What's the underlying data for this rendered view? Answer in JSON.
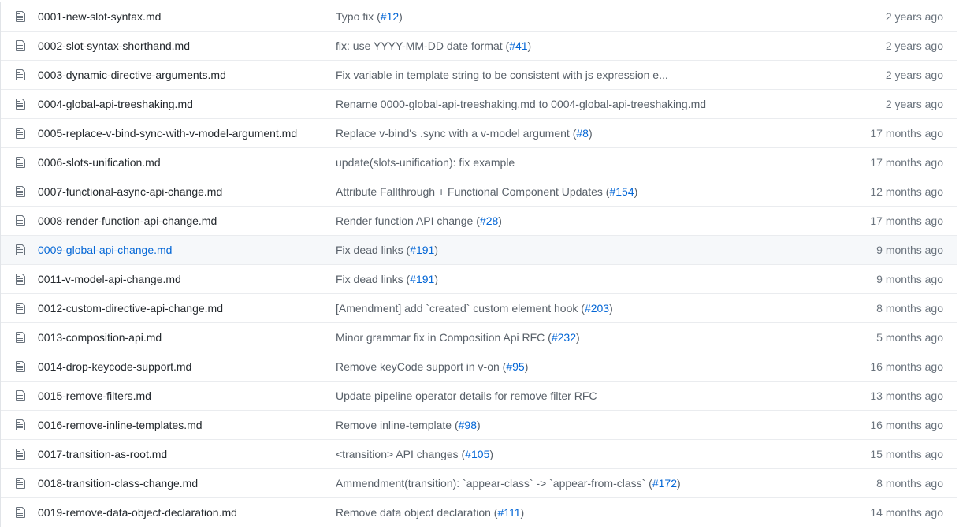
{
  "colors": {
    "text": "#24292e",
    "muted": "#586069",
    "link": "#0366d6",
    "border": "#eaecef",
    "hover_bg": "#f6f8fa"
  },
  "rows": [
    {
      "name": "0001-new-slot-syntax.md",
      "message": "Typo fix (",
      "pr": "#12",
      "message_end": ")",
      "age": "2 years ago",
      "icon": "file-icon"
    },
    {
      "name": "0002-slot-syntax-shorthand.md",
      "message": "fix: use YYYY-MM-DD date format (",
      "pr": "#41",
      "message_end": ")",
      "age": "2 years ago",
      "icon": "file-icon"
    },
    {
      "name": "0003-dynamic-directive-arguments.md",
      "message": "Fix variable in template string to be consistent with js expression e...",
      "pr": "",
      "message_end": "",
      "age": "2 years ago",
      "icon": "file-icon"
    },
    {
      "name": "0004-global-api-treeshaking.md",
      "message": "Rename 0000-global-api-treeshaking.md to 0004-global-api-treeshaking.md",
      "pr": "",
      "message_end": "",
      "age": "2 years ago",
      "icon": "file-icon"
    },
    {
      "name": "0005-replace-v-bind-sync-with-v-model-argument.md",
      "message": "Replace v-bind's .sync with a v-model argument (",
      "pr": "#8",
      "message_end": ")",
      "age": "17 months ago",
      "icon": "file-icon"
    },
    {
      "name": "0006-slots-unification.md",
      "message": "update(slots-unification): fix example",
      "pr": "",
      "message_end": "",
      "age": "17 months ago",
      "icon": "file-icon"
    },
    {
      "name": "0007-functional-async-api-change.md",
      "message": "Attribute Fallthrough + Functional Component Updates (",
      "pr": "#154",
      "message_end": ")",
      "age": "12 months ago",
      "icon": "file-icon"
    },
    {
      "name": "0008-render-function-api-change.md",
      "message": "Render function API change (",
      "pr": "#28",
      "message_end": ")",
      "age": "17 months ago",
      "icon": "file-icon"
    },
    {
      "name": "0009-global-api-change.md",
      "message": "Fix dead links (",
      "pr": "#191",
      "message_end": ")",
      "age": "9 months ago",
      "icon": "file-icon",
      "hover": true
    },
    {
      "name": "0011-v-model-api-change.md",
      "message": "Fix dead links (",
      "pr": "#191",
      "message_end": ")",
      "age": "9 months ago",
      "icon": "file-icon"
    },
    {
      "name": "0012-custom-directive-api-change.md",
      "message": "[Amendment] add `created` custom element hook (",
      "pr": "#203",
      "message_end": ")",
      "age": "8 months ago",
      "icon": "file-icon"
    },
    {
      "name": "0013-composition-api.md",
      "message": "Minor grammar fix in Composition Api RFC (",
      "pr": "#232",
      "message_end": ")",
      "age": "5 months ago",
      "icon": "file-icon"
    },
    {
      "name": "0014-drop-keycode-support.md",
      "message": "Remove keyCode support in v-on (",
      "pr": "#95",
      "message_end": ")",
      "age": "16 months ago",
      "icon": "file-icon"
    },
    {
      "name": "0015-remove-filters.md",
      "message": "Update pipeline operator details for remove filter RFC",
      "pr": "",
      "message_end": "",
      "age": "13 months ago",
      "icon": "file-icon"
    },
    {
      "name": "0016-remove-inline-templates.md",
      "message": "Remove inline-template (",
      "pr": "#98",
      "message_end": ")",
      "age": "16 months ago",
      "icon": "file-icon"
    },
    {
      "name": "0017-transition-as-root.md",
      "message": "<transition> API changes (",
      "pr": "#105",
      "message_end": ")",
      "age": "15 months ago",
      "icon": "file-icon"
    },
    {
      "name": "0018-transition-class-change.md",
      "message": "Ammendment(transition): `appear-class` -> `appear-from-class` (",
      "pr": "#172",
      "message_end": ")",
      "age": "8 months ago",
      "icon": "file-icon"
    },
    {
      "name": "0019-remove-data-object-declaration.md",
      "message": "Remove data object declaration (",
      "pr": "#111",
      "message_end": ")",
      "age": "14 months ago",
      "icon": "file-icon"
    }
  ]
}
